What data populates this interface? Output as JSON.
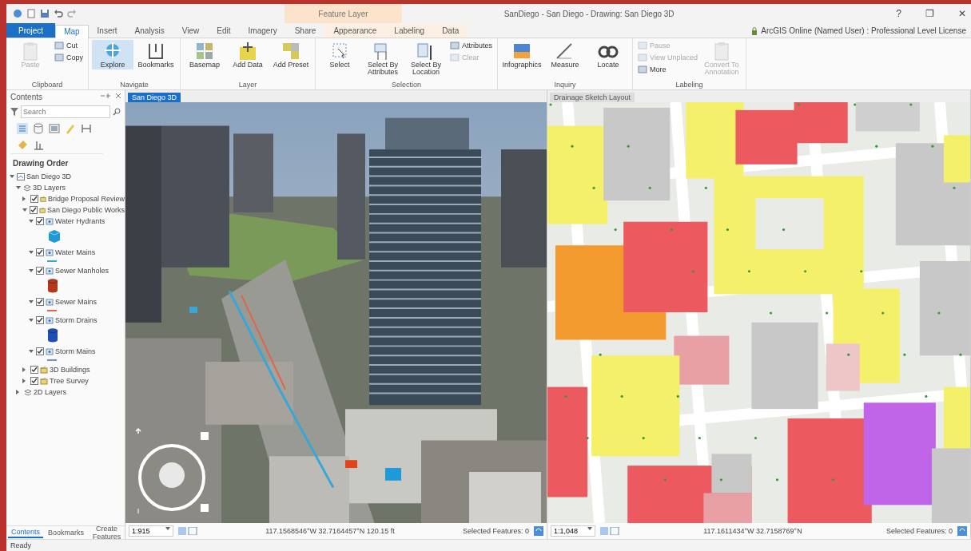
{
  "window": {
    "title": "SanDiego - San Diego - Drawing: San Diego 3D",
    "contextual_group": "Feature Layer",
    "controls": [
      "?",
      "❐",
      "✕"
    ]
  },
  "ribbon_tabs": [
    {
      "label": "Project",
      "kind": "backstage",
      "selected": false
    },
    {
      "label": "Map",
      "kind": "normal",
      "selected": true
    },
    {
      "label": "Insert",
      "kind": "normal",
      "selected": false
    },
    {
      "label": "Analysis",
      "kind": "normal",
      "selected": false
    },
    {
      "label": "View",
      "kind": "normal",
      "selected": false
    },
    {
      "label": "Edit",
      "kind": "normal",
      "selected": false
    },
    {
      "label": "Imagery",
      "kind": "normal",
      "selected": false
    },
    {
      "label": "Share",
      "kind": "normal",
      "selected": false
    },
    {
      "label": "Appearance",
      "kind": "contextual",
      "selected": false
    },
    {
      "label": "Labeling",
      "kind": "contextual",
      "selected": false
    },
    {
      "label": "Data",
      "kind": "contextual",
      "selected": false
    }
  ],
  "user": "ArcGIS Online (Named User) : Professional Level License",
  "ribbon_groups": [
    {
      "label": "Clipboard",
      "buttons": [
        {
          "label": "Paste",
          "kind": "large",
          "disabled": true,
          "active": false
        },
        {
          "label": "Cut",
          "kind": "small",
          "disabled": false,
          "active": false
        },
        {
          "label": "Copy",
          "kind": "small",
          "disabled": false,
          "active": false
        }
      ]
    },
    {
      "label": "Navigate",
      "buttons": [
        {
          "label": "Explore",
          "kind": "large",
          "disabled": false,
          "active": true
        },
        {
          "label": "Bookmarks",
          "kind": "large",
          "disabled": false,
          "active": false
        }
      ]
    },
    {
      "label": "Layer",
      "buttons": [
        {
          "label": "Basemap",
          "kind": "large",
          "disabled": false,
          "active": false
        },
        {
          "label": "Add Data",
          "kind": "large",
          "disabled": false,
          "active": false
        },
        {
          "label": "Add Preset",
          "kind": "large",
          "disabled": false,
          "active": false
        }
      ]
    },
    {
      "label": "Selection",
      "buttons": [
        {
          "label": "Select",
          "kind": "large",
          "disabled": false,
          "active": false
        },
        {
          "label": "Select By Attributes",
          "kind": "large",
          "disabled": false,
          "active": false
        },
        {
          "label": "Select By Location",
          "kind": "large",
          "disabled": false,
          "active": false
        },
        {
          "label": "Attributes",
          "kind": "small",
          "disabled": false,
          "active": false
        },
        {
          "label": "Clear",
          "kind": "small",
          "disabled": true,
          "active": false
        }
      ]
    },
    {
      "label": "Inquiry",
      "buttons": [
        {
          "label": "Infographics",
          "kind": "large",
          "disabled": false,
          "active": false
        },
        {
          "label": "Measure",
          "kind": "large",
          "disabled": false,
          "active": false
        },
        {
          "label": "Locate",
          "kind": "large",
          "disabled": false,
          "active": false
        }
      ]
    },
    {
      "label": "Labeling",
      "buttons": [
        {
          "label": "Pause",
          "kind": "small",
          "disabled": true,
          "active": false
        },
        {
          "label": "View Unplaced",
          "kind": "small",
          "disabled": true,
          "active": false
        },
        {
          "label": "More",
          "kind": "small",
          "disabled": false,
          "active": false
        },
        {
          "label": "Convert To Annotation",
          "kind": "large",
          "disabled": true,
          "active": false
        }
      ]
    }
  ],
  "contents": {
    "title": "Contents",
    "search_placeholder": "Search",
    "heading": "Drawing Order",
    "tree": [
      {
        "label": "San Diego 3D",
        "kind": "map",
        "expanded": true,
        "children": [
          {
            "label": "3D Layers",
            "kind": "category",
            "expanded": true,
            "children": [
              {
                "label": "Bridge Proposal Review",
                "kind": "group",
                "expanded": false,
                "checked": true
              },
              {
                "label": "San Diego Public Works",
                "kind": "group",
                "expanded": true,
                "checked": true,
                "children": [
                  {
                    "label": "Water Hydrants",
                    "kind": "layer",
                    "expanded": true,
                    "checked": true,
                    "symbol": {
                      "kind": "cube",
                      "color": "#1e9ad6"
                    }
                  },
                  {
                    "label": "Water Mains",
                    "kind": "layer",
                    "expanded": true,
                    "checked": true,
                    "symbol": {
                      "kind": "line",
                      "color": "#3aa6d8"
                    }
                  },
                  {
                    "label": "Sewer Manholes",
                    "kind": "layer",
                    "expanded": true,
                    "checked": true,
                    "symbol": {
                      "kind": "cylinder",
                      "color": "#b5381a"
                    }
                  },
                  {
                    "label": "Sewer Mains",
                    "kind": "layer",
                    "expanded": true,
                    "checked": true,
                    "symbol": {
                      "kind": "line",
                      "color": "#e0654a"
                    }
                  },
                  {
                    "label": "Storm Drains",
                    "kind": "layer",
                    "expanded": true,
                    "checked": true,
                    "symbol": {
                      "kind": "cylinder",
                      "color": "#1f4fb5"
                    }
                  },
                  {
                    "label": "Storm Mains",
                    "kind": "layer",
                    "expanded": true,
                    "checked": true,
                    "symbol": {
                      "kind": "line",
                      "color": "#6b8fd6"
                    }
                  }
                ]
              },
              {
                "label": "3D Buildings",
                "kind": "group",
                "expanded": false,
                "checked": true
              },
              {
                "label": "Tree Survey",
                "kind": "group",
                "expanded": false,
                "checked": true
              }
            ]
          },
          {
            "label": "2D Layers",
            "kind": "category",
            "expanded": false
          }
        ]
      }
    ],
    "tabs": [
      {
        "label": "Contents",
        "selected": true
      },
      {
        "label": "Bookmarks",
        "selected": false
      },
      {
        "label": "Create Features",
        "selected": false
      }
    ]
  },
  "views": [
    {
      "kind": "scene",
      "tab": "San Diego 3D",
      "selected": true,
      "scale": "1:915",
      "coordinates": "117.1568546°W 32.7164457°N 120.15 ft",
      "selected_features": "Selected Features: 0"
    },
    {
      "kind": "map",
      "tab": "Drainage Sketch Layout",
      "selected": false,
      "scale": "1:1,048",
      "coordinates": "117.1611434°W 32.7158769°N",
      "selected_features": "Selected Features: 0"
    }
  ],
  "status_bar": "Ready"
}
